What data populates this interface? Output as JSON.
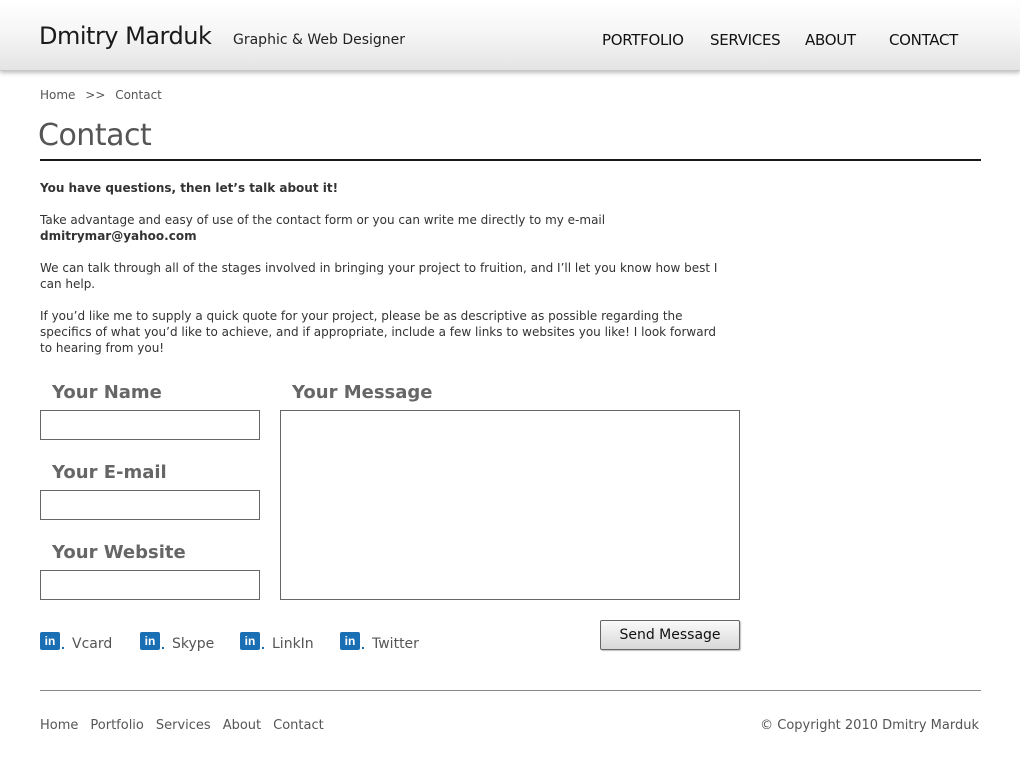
{
  "header": {
    "brand_name": "Dmitry Marduk",
    "tagline": "Graphic & Web Designer",
    "nav": [
      "PORTFOLIO",
      "SERVICES",
      "ABOUT",
      "CONTACT"
    ]
  },
  "breadcrumb": {
    "home": "Home",
    "separator": ">>",
    "current": "Contact"
  },
  "page_title": "Contact",
  "intro": {
    "lead": "You have questions, then let’s talk about it!",
    "p1": "Take advantage and easy of use of the contact form or you can write me directly to my e-mail",
    "email": "dmitrymar@yahoo.com",
    "p2": "We can talk through all of the stages involved in bringing your project to fruition, and I’ll let you know how best I can help.",
    "p3": "If you’d like me to supply a quick quote for your project, please be as descriptive as possible regarding the specifics of what you’d like to achieve, and if appropriate, include a few links to websites you like! I look forward to hearing from you!"
  },
  "form": {
    "name_label": "Your Name",
    "name_value": "",
    "email_label": "Your E-mail",
    "email_value": "",
    "website_label": "Your Website",
    "website_value": "",
    "message_label": "Your Message",
    "message_value": "",
    "submit_label": "Send Message"
  },
  "social": [
    {
      "icon": "linkedin-icon",
      "icon_text": "in",
      "label": "Vcard"
    },
    {
      "icon": "linkedin-icon",
      "icon_text": "in",
      "label": "Skype"
    },
    {
      "icon": "linkedin-icon",
      "icon_text": "in",
      "label": "LinkIn"
    },
    {
      "icon": "linkedin-icon",
      "icon_text": "in",
      "label": "Twitter"
    }
  ],
  "footer": {
    "nav": [
      "Home",
      "Portfolio",
      "Services",
      "About",
      "Contact"
    ],
    "copyright": "© Copyright 2010 Dmitry Marduk"
  },
  "colors": {
    "social_icon": "#1a6fb4",
    "label_gray": "#666666",
    "rule_dark": "#1a1a1a"
  }
}
